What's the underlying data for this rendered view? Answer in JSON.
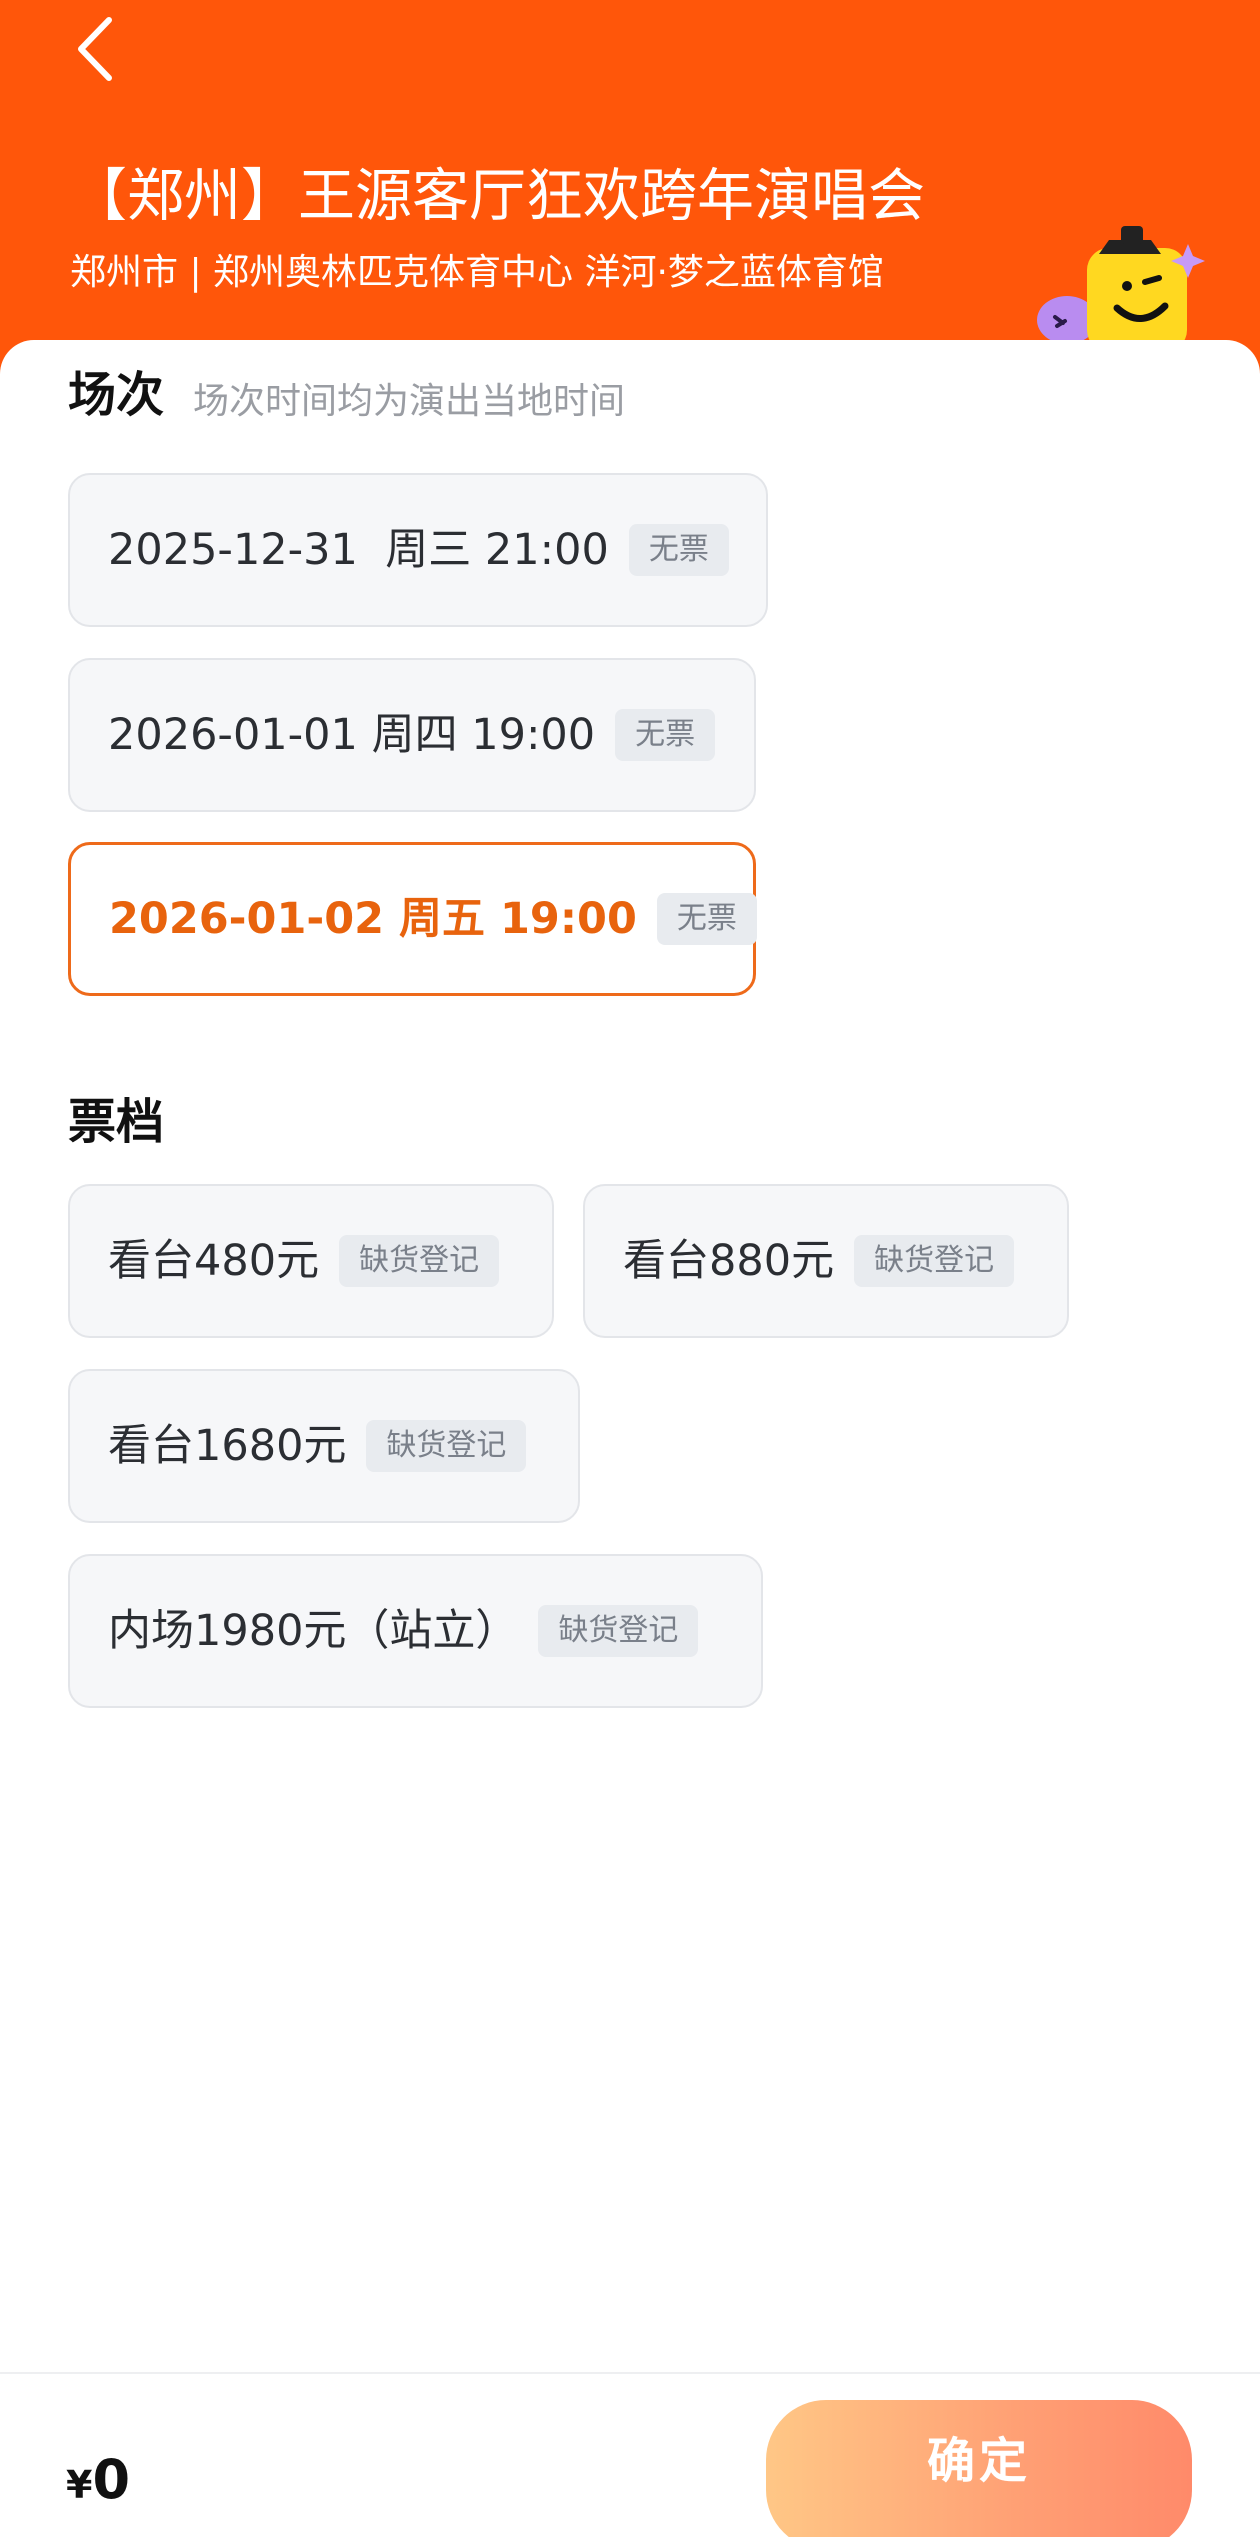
{
  "header": {
    "title": "【郑州】王源客厅狂欢跨年演唱会",
    "venue": "郑州市 | 郑州奥林匹克体育中心 洋河·梦之蓝体育馆"
  },
  "sessions": {
    "title": "场次",
    "hint": "场次时间均为演出当地时间",
    "items": [
      {
        "label": "2025-12-31  周三 21:00",
        "tag": "无票",
        "selected": false
      },
      {
        "label": "2026-01-01 周四 19:00",
        "tag": "无票",
        "selected": false
      },
      {
        "label": "2026-01-02 周五 19:00",
        "tag": "无票",
        "selected": true
      }
    ]
  },
  "tiers": {
    "title": "票档",
    "items": [
      {
        "label": "看台480元",
        "tag": "缺货登记"
      },
      {
        "label": "看台880元",
        "tag": "缺货登记"
      },
      {
        "label": "看台1680元",
        "tag": "缺货登记"
      },
      {
        "label": "内场1980元（站立）",
        "tag": "缺货登记"
      }
    ]
  },
  "footer": {
    "currency": "¥",
    "amount": "0",
    "confirm_label": "确定"
  },
  "colors": {
    "brand_orange": "#ff560a",
    "selected_accent": "#e8630d"
  },
  "icons": {
    "back": "chevron-left-icon",
    "mascot": "mascot-icon"
  }
}
